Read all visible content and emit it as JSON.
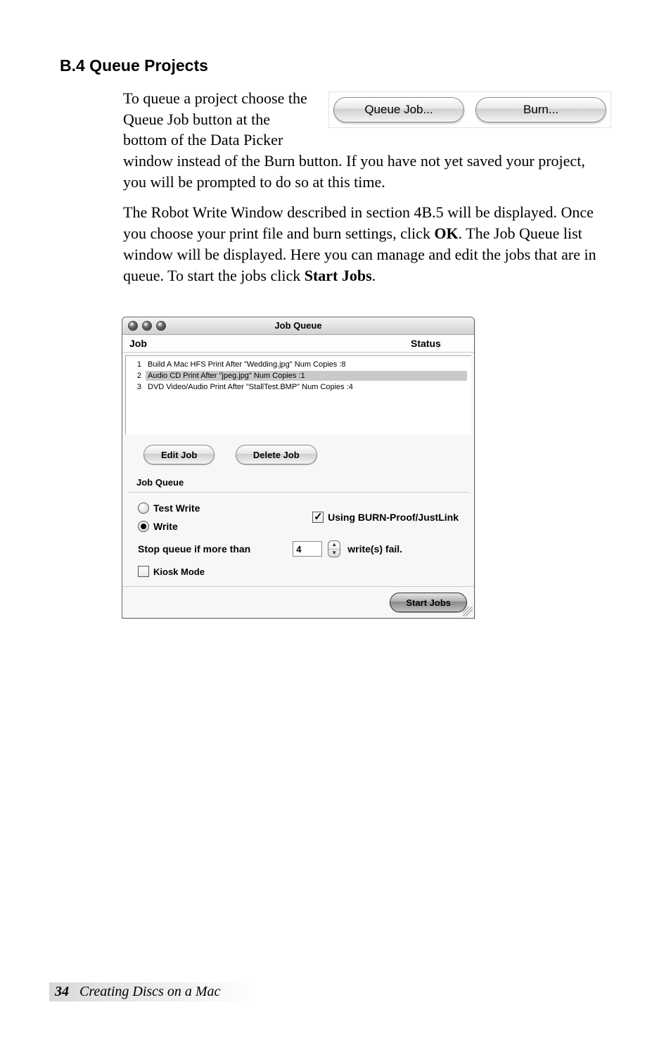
{
  "section": {
    "heading": "B.4 Queue Projects",
    "para1a": "To queue a project choose the Queue Job button at the bottom of the Data Picker window instead of the Burn button. If ",
    "para1b": "you have not yet saved your project, you will be prompted to do so at this time.",
    "para2a": "The Robot Write Window described in section 4B.5 will be displayed. Once you choose your print file and burn settings, click ",
    "para2_ok": "OK",
    "para2b": ". The Job Queue list window will be displayed. Here you can manage and edit the jobs that are in queue. To start the jobs click ",
    "para2_start": "Start Jobs",
    "para2c": "."
  },
  "float_buttons": {
    "queue": "Queue Job...",
    "burn": "Burn..."
  },
  "job_queue": {
    "title": "Job Queue",
    "col_job": "Job",
    "col_status": "Status",
    "rows": [
      {
        "num": "1",
        "text": "Build A Mac HFS Print After \"Wedding.jpg\"  Num Copies :8",
        "selected": false
      },
      {
        "num": "2",
        "text": "Audio CD Print After \"jpeg.jpg\"  Num Copies :1",
        "selected": true
      },
      {
        "num": "3",
        "text": "DVD Video/Audio Print After \"StallTest.BMP\"  Num Copies :4",
        "selected": false
      }
    ],
    "edit_btn": "Edit Job",
    "delete_btn": "Delete Job",
    "section_label": "Job Queue",
    "opt_test_write": "Test Write",
    "opt_write": "Write",
    "opt_burnproof": "Using BURN-Proof/JustLink",
    "stop_prefix": "Stop queue if more than",
    "stop_value": "4",
    "stop_suffix": "write(s) fail.",
    "kiosk": "Kiosk Mode",
    "start_btn": "Start Jobs"
  },
  "footer": {
    "page_num": "34",
    "chapter": "Creating Discs on a Mac"
  }
}
